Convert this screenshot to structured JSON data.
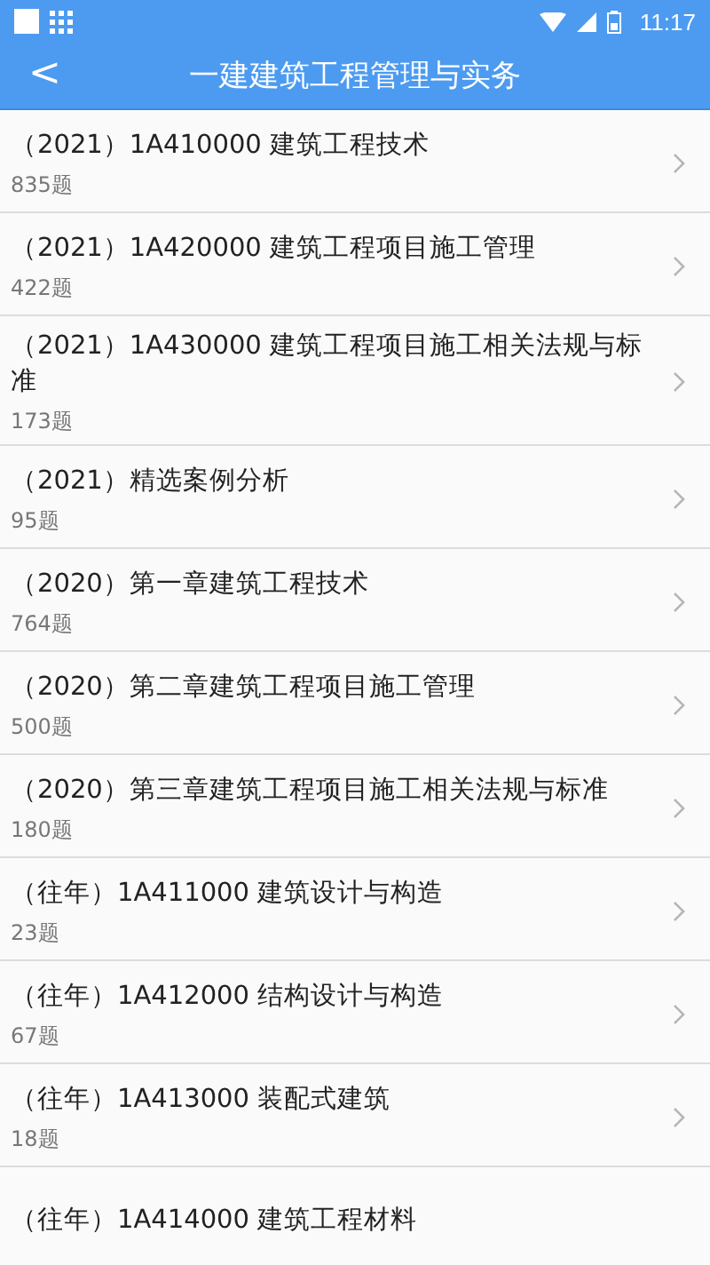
{
  "status_bar": {
    "time": "11:17"
  },
  "header": {
    "back": "<",
    "title": "一建建筑工程管理与实务"
  },
  "items": [
    {
      "title": "（2021）1A410000  建筑工程技术",
      "count": "835题"
    },
    {
      "title": "（2021）1A420000 建筑工程项目施工管理",
      "count": "422题"
    },
    {
      "title": "（2021）1A430000 建筑工程项目施工相关法规与标准",
      "count": "173题"
    },
    {
      "title": "（2021）精选案例分析",
      "count": "95题"
    },
    {
      "title": "（2020）第一章建筑工程技术",
      "count": "764题"
    },
    {
      "title": "（2020）第二章建筑工程项目施工管理",
      "count": "500题"
    },
    {
      "title": "（2020）第三章建筑工程项目施工相关法规与标准",
      "count": "180题"
    },
    {
      "title": "（往年）1A411000 建筑设计与构造",
      "count": "23题"
    },
    {
      "title": "（往年）1A412000 结构设计与构造",
      "count": "67题"
    },
    {
      "title": "（往年）1A413000 装配式建筑",
      "count": "18题"
    },
    {
      "title": "（往年）1A414000 建筑工程材料"
    }
  ]
}
